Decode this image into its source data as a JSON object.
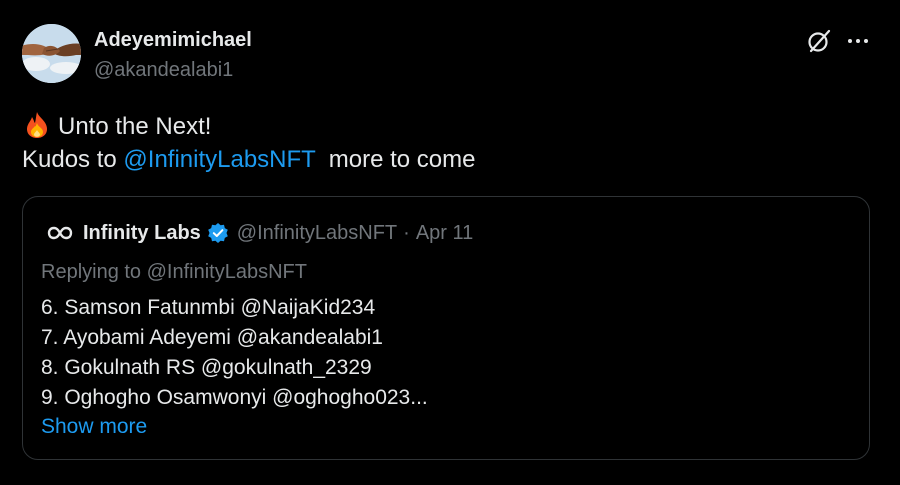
{
  "author": {
    "display_name": "Adeyemimichael",
    "handle": "@akandealabi1",
    "avatar": "avatar"
  },
  "header_icons": [
    "grok-icon",
    "more-icon"
  ],
  "body": {
    "line1": "Unto the Next!",
    "line1_icon": "fire-emoji",
    "line2_prefix": "Kudos to ",
    "line2_mention": "@InfinityLabsNFT",
    "line2_suffix": "  more to come"
  },
  "quoted_tweet": {
    "author_name": "Infinity Labs",
    "author_handle": "@InfinityLabsNFT",
    "separator": "·",
    "date": "Apr 11",
    "verified": true,
    "replying_to": "Replying to @InfinityLabsNFT",
    "lines": [
      "6. Samson Fatunmbi @NaijaKid234",
      "7. Ayobami Adeyemi @akandealabi1",
      "8. Gokulnath RS @gokulnath_2329",
      "9. Oghogho Osamwonyi @oghogho023..."
    ],
    "show_more": "Show more"
  },
  "colors": {
    "background": "#000000",
    "text": "#e7e9ea",
    "secondary": "#71767b",
    "accent": "#1d9bf0",
    "border": "#2f3336"
  }
}
